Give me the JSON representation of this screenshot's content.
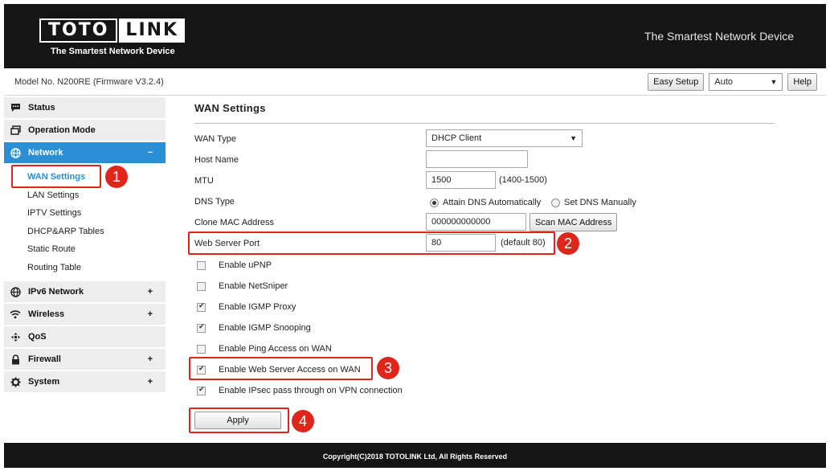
{
  "header": {
    "logo_left": "TOTO",
    "logo_right": "LINK",
    "logo_tagline": "The Smartest Network Device",
    "slogan": "The Smartest Network Device"
  },
  "topbar": {
    "model": "Model No. N200RE (Firmware V3.2.4)",
    "easy_setup": "Easy Setup",
    "language": "Auto",
    "help": "Help"
  },
  "sidebar": {
    "items": [
      {
        "label": "Status",
        "icon": "chat-bubble-icon"
      },
      {
        "label": "Operation Mode",
        "icon": "window-icon"
      },
      {
        "label": "Network",
        "icon": "globe-icon",
        "sign": "−"
      },
      {
        "label": "IPv6 Network",
        "icon": "globe-icon",
        "sign": "+"
      },
      {
        "label": "Wireless",
        "icon": "wifi-icon",
        "sign": "+"
      },
      {
        "label": "QoS",
        "icon": "qos-icon"
      },
      {
        "label": "Firewall",
        "icon": "lock-icon",
        "sign": "+"
      },
      {
        "label": "System",
        "icon": "gear-icon",
        "sign": "+"
      }
    ],
    "network_sub": [
      "WAN Settings",
      "LAN Settings",
      "IPTV Settings",
      "DHCP&ARP Tables",
      "Static Route",
      "Routing Table"
    ]
  },
  "main": {
    "title": "WAN Settings",
    "wan_type_label": "WAN Type",
    "wan_type_value": "DHCP Client",
    "host_name_label": "Host Name",
    "host_name_value": "",
    "mtu_label": "MTU",
    "mtu_value": "1500",
    "mtu_hint": "(1400-1500)",
    "dns_type_label": "DNS Type",
    "dns_auto": "Attain DNS Automatically",
    "dns_manual": "Set DNS Manually",
    "clone_mac_label": "Clone MAC Address",
    "clone_mac_value": "000000000000",
    "scan_mac": "Scan MAC Address",
    "web_port_label": "Web Server Port",
    "web_port_value": "80",
    "web_port_hint": "(default 80)",
    "checkboxes": [
      {
        "label": "Enable uPNP",
        "checked": false
      },
      {
        "label": "Enable NetSniper",
        "checked": false
      },
      {
        "label": "Enable IGMP Proxy",
        "checked": true
      },
      {
        "label": "Enable IGMP Snooping",
        "checked": true
      },
      {
        "label": "Enable Ping Access on WAN",
        "checked": false
      },
      {
        "label": "Enable Web Server Access on WAN",
        "checked": true
      },
      {
        "label": "Enable IPsec pass through on VPN connection",
        "checked": true
      }
    ],
    "apply": "Apply"
  },
  "annotations": [
    "1",
    "2",
    "3",
    "4"
  ],
  "footer": {
    "copyright": "Copyright(C)2018 TOTOLINK Ltd, All Rights Reserved"
  }
}
